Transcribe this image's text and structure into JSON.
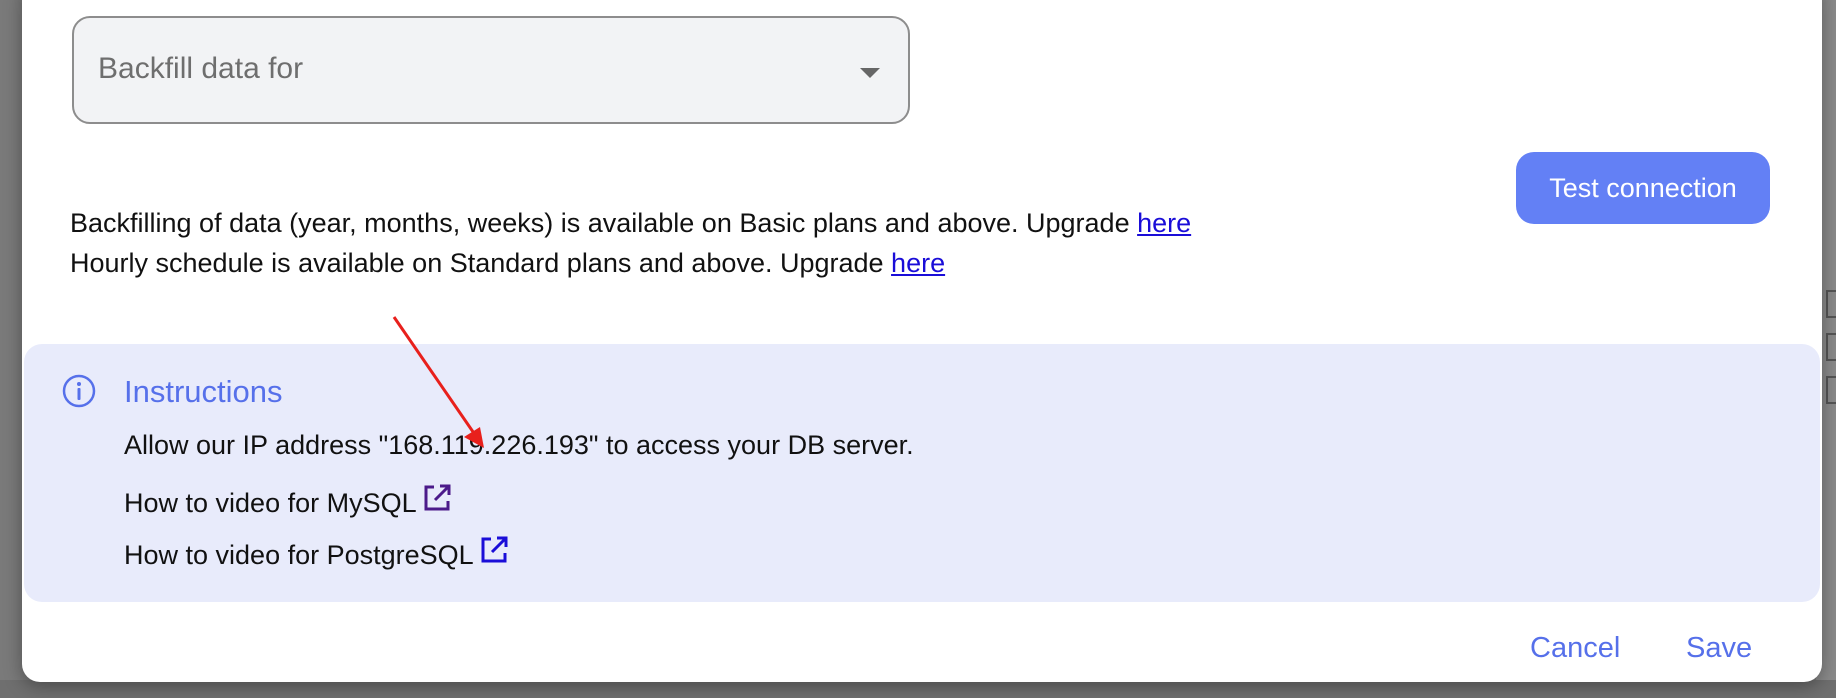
{
  "backfill_select": {
    "placeholder": "Backfill data for"
  },
  "test_connection": {
    "label": "Test connection"
  },
  "plan_notes": [
    {
      "text": "Backfilling of data (year, months, weeks) is available on Basic plans and above. Upgrade ",
      "link": "here"
    },
    {
      "text": "Hourly schedule is available on Standard plans and above. Upgrade ",
      "link": "here"
    }
  ],
  "instructions": {
    "title": "Instructions",
    "ip_line": "Allow our IP address \"168.119.226.193\" to access your DB server.",
    "mysql_line": "How to video for MySQL",
    "postgres_line": "How to video for PostgreSQL"
  },
  "footer": {
    "cancel": "Cancel",
    "save": "Save"
  },
  "colors": {
    "accent": "#6380f5",
    "link": "#1a0dd8",
    "instructions_bg": "#e8ebfb",
    "annotation": "#e8201c"
  },
  "icons": {
    "info": "info-circle-icon",
    "external": "external-link-icon",
    "dropdown": "caret-down-icon"
  }
}
